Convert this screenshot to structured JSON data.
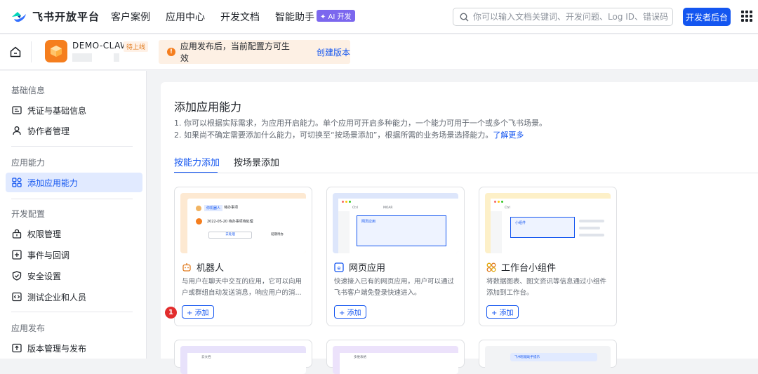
{
  "topbar": {
    "logo_text": "飞书开放平台",
    "nav": [
      {
        "label": "客户案例"
      },
      {
        "label": "应用中心"
      },
      {
        "label": "开发文档"
      },
      {
        "label": "智能助手",
        "badge": "✦ AI 开发"
      }
    ],
    "search_placeholder": "你可以输入文档关键词、开发问题、Log ID、错误码",
    "dev_console_label": "开发者后台"
  },
  "appbar": {
    "app_name": "DEMO-CLAW",
    "app_status": "待上线",
    "notice_text": "应用发布后，当前配置方可生效",
    "notice_link": "创建版本"
  },
  "sidebar": {
    "groups": [
      {
        "label": "基础信息",
        "items": [
          {
            "label": "凭证与基础信息"
          },
          {
            "label": "协作者管理"
          }
        ]
      },
      {
        "label": "应用能力",
        "items": [
          {
            "label": "添加应用能力",
            "active": true
          }
        ]
      },
      {
        "label": "开发配置",
        "items": [
          {
            "label": "权限管理"
          },
          {
            "label": "事件与回调"
          },
          {
            "label": "安全设置"
          },
          {
            "label": "测试企业和人员"
          }
        ]
      },
      {
        "label": "应用发布",
        "items": [
          {
            "label": "版本管理与发布"
          }
        ]
      }
    ]
  },
  "main": {
    "title": "添加应用能力",
    "desc1": "1. 你可以根据实际需求，为应用开启能力。单个应用可开启多种能力，一个能力可用于一个或多个飞书场景。",
    "desc2": "2. 如果尚不确定需要添加什么能力，可切换至“按场景添加”，根据所需的业务场景选择能力。",
    "desc2_link": "了解更多",
    "tabs": [
      {
        "label": "按能力添加",
        "active": true
      },
      {
        "label": "按场景添加"
      }
    ],
    "cards": [
      {
        "title": "机器人",
        "desc": "与用户在聊天中交互的应用，它可以向用户或群组自动发送消息，响应用户的消...",
        "add_label": "+ 添加",
        "icon": "robot-icon",
        "thumb": {
          "chip_a": "你机器人",
          "chip_b": "待办事项",
          "line": "2022-05-20 待办事项待处理",
          "btn_a": "去处理",
          "btn_b": "延期待办"
        }
      },
      {
        "title": "网页应用",
        "desc": "快速接入已有的网页应用，用户可以通过飞书客户端免登录快速进入。",
        "add_label": "+ 添加",
        "icon": "webpage-icon",
        "thumb": {
          "tab_a": "Ctrl",
          "tab_b": "MOAR",
          "box": "网页应用"
        }
      },
      {
        "title": "工作台小组件",
        "desc": "将数据图表、图文资讯等信息通过小组件添加到工作台。",
        "add_label": "+ 添加",
        "icon": "widget-icon",
        "thumb": {
          "tab_a": "Ctrl",
          "box": "小组件"
        }
      }
    ],
    "step_badge": "1",
    "bottom_thumbs": {
      "a": "云文档",
      "b": "多维表格",
      "c": "飞书智能助手提示"
    }
  }
}
